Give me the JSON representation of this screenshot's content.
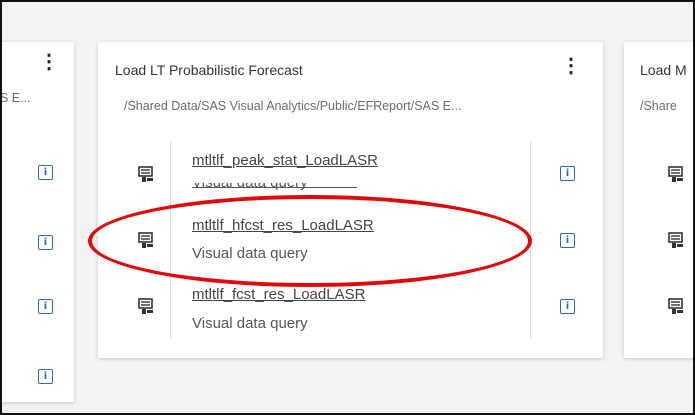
{
  "cards": {
    "left": {
      "path_fragment": "S E...",
      "kebab": "⋮",
      "info_icons": [
        "i",
        "i",
        "i",
        "i"
      ]
    },
    "main": {
      "title": "Load LT Probabilistic Forecast",
      "path": "/Shared Data/SAS Visual Analytics/Public/EFReport/SAS E...",
      "kebab": "⋮",
      "items": [
        {
          "name": "mtltlf_peak_stat_LoadLASR",
          "type": "Visual data query",
          "icon": "query-icon",
          "info": "i"
        },
        {
          "name": "mtltlf_hfcst_res_LoadLASR",
          "type": "Visual data query",
          "icon": "query-icon",
          "info": "i"
        },
        {
          "name": "mtltlf_fcst_res_LoadLASR",
          "type": "Visual data query",
          "icon": "query-icon",
          "info": "i"
        }
      ]
    },
    "right": {
      "title_fragment": "Load M",
      "path_fragment": "/Share"
    }
  },
  "annotation": {
    "shape": "ellipse",
    "color": "#e10a0a",
    "highlights": "mtltlf_hfcst_res_LoadLASR"
  },
  "colors": {
    "info_blue": "#2a6ab8",
    "background": "#f2f3f5",
    "card": "#ffffff"
  }
}
